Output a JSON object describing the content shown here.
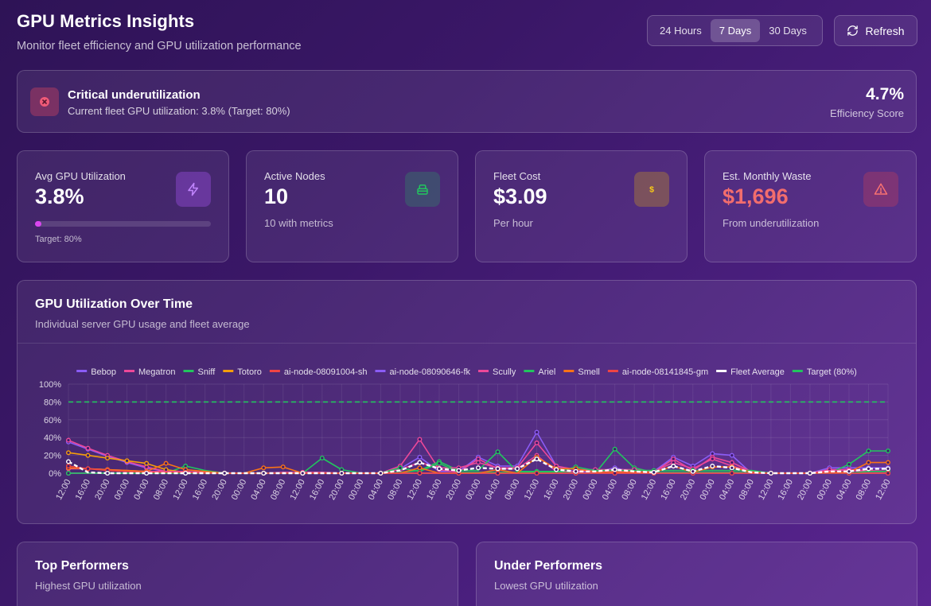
{
  "header": {
    "title": "GPU Metrics Insights",
    "subtitle": "Monitor fleet efficiency and GPU utilization performance"
  },
  "time_range": {
    "options": [
      "24 Hours",
      "7 Days",
      "30 Days"
    ],
    "selected": "7 Days"
  },
  "refresh_label": "Refresh",
  "alert": {
    "title": "Critical underutilization",
    "message": "Current fleet GPU utilization: 3.8% (Target: 80%)",
    "score": "4.7%",
    "score_label": "Efficiency Score",
    "icon": "x-circle-icon"
  },
  "stats": {
    "avg_gpu": {
      "label": "Avg GPU Utilization",
      "value": "3.8%",
      "progress": 0.038,
      "note": "Target: 80%",
      "icon": "lightning-icon"
    },
    "active_nodes": {
      "label": "Active Nodes",
      "value": "10",
      "sub": "10 with metrics",
      "icon": "server-icon"
    },
    "fleet_cost": {
      "label": "Fleet Cost",
      "value": "$3.09",
      "sub": "Per hour",
      "icon": "dollar-icon"
    },
    "monthly_waste": {
      "label": "Est. Monthly Waste",
      "value": "$1,696",
      "sub": "From underutilization",
      "icon": "warning-icon"
    }
  },
  "colors": {
    "accent": "#d946ef",
    "waste": "#f26d6d",
    "nodes_icon": "#22c55e",
    "cost_icon": "#facc15",
    "waste_icon": "#f87171",
    "lightning_icon": "#c084fc"
  },
  "chart_card": {
    "title": "GPU Utilization Over Time",
    "subtitle": "Individual server GPU usage and fleet average"
  },
  "chart_data": {
    "type": "line",
    "x": [
      "12:00",
      "16:00",
      "20:00",
      "00:00",
      "04:00",
      "08:00",
      "12:00",
      "16:00",
      "20:00",
      "00:00",
      "04:00",
      "08:00",
      "12:00",
      "16:00",
      "20:00",
      "00:00",
      "04:00",
      "08:00",
      "12:00",
      "16:00",
      "20:00",
      "00:00",
      "04:00",
      "08:00",
      "12:00",
      "16:00",
      "20:00",
      "00:00",
      "04:00",
      "08:00",
      "12:00",
      "16:00",
      "20:00",
      "00:00",
      "04:00",
      "08:00",
      "12:00",
      "16:00",
      "20:00",
      "00:00",
      "04:00",
      "08:00",
      "12:00"
    ],
    "ylim": [
      0,
      100
    ],
    "yticks": [
      "0%",
      "20%",
      "40%",
      "60%",
      "80%",
      "100%"
    ],
    "legend_position": "top",
    "grid": true,
    "series": [
      {
        "name": "Bebop",
        "color": "#8b5cf6",
        "values": [
          35,
          27,
          19,
          12,
          6,
          2,
          1,
          1,
          0,
          0,
          0,
          0,
          0,
          0,
          0,
          0,
          0,
          5,
          18,
          2,
          2,
          18,
          8,
          8,
          46,
          8,
          1,
          1,
          6,
          1,
          2,
          18,
          8,
          22,
          20,
          0,
          0,
          0,
          0,
          6,
          6,
          6,
          6
        ]
      },
      {
        "name": "Megatron",
        "color": "#ec4899",
        "values": [
          37,
          28,
          20,
          13,
          7,
          2,
          0,
          1,
          0,
          0,
          0,
          0,
          0,
          0,
          0,
          0,
          0,
          8,
          38,
          4,
          1,
          16,
          5,
          5,
          20,
          2,
          2,
          3,
          2,
          2,
          1,
          16,
          3,
          18,
          12,
          2,
          0,
          0,
          0,
          4,
          4,
          3,
          2
        ]
      },
      {
        "name": "Sniff",
        "color": "#22c55e",
        "values": [
          0,
          0,
          0,
          0,
          0,
          0,
          8,
          3,
          0,
          0,
          0,
          0,
          0,
          17,
          4,
          0,
          0,
          1,
          3,
          13,
          3,
          3,
          24,
          2,
          2,
          2,
          0,
          0,
          27,
          6,
          1,
          1,
          1,
          1,
          1,
          1,
          0,
          0,
          0,
          0,
          10,
          25,
          25
        ]
      },
      {
        "name": "Totoro",
        "color": "#f59e0b",
        "values": [
          23,
          20,
          17,
          14,
          11,
          4,
          1,
          0,
          0,
          0,
          0,
          0,
          0,
          0,
          0,
          0,
          0,
          0,
          0,
          0,
          0,
          0,
          0,
          0,
          0,
          0,
          0,
          0,
          0,
          0,
          0,
          0,
          0,
          0,
          0,
          0,
          0,
          0,
          0,
          0,
          0,
          0,
          0
        ]
      },
      {
        "name": "ai-node-08091004-sh",
        "color": "#ef4444",
        "values": [
          0,
          0,
          0,
          0,
          0,
          0,
          0,
          0,
          0,
          0,
          0,
          0,
          0,
          0,
          0,
          0,
          0,
          0,
          0,
          0,
          0,
          0,
          0,
          0,
          0,
          0,
          0,
          0,
          0,
          0,
          0,
          0,
          0,
          0,
          0,
          0,
          0,
          0,
          0,
          0,
          0,
          0,
          0
        ]
      },
      {
        "name": "ai-node-08090646-fk",
        "color": "#8b5cf6",
        "values": [
          0,
          0,
          0,
          0,
          0,
          0,
          0,
          0,
          0,
          0,
          0,
          0,
          0,
          0,
          0,
          0,
          0,
          0,
          0,
          0,
          0,
          0,
          0,
          0,
          0,
          0,
          0,
          0,
          0,
          0,
          0,
          0,
          0,
          0,
          0,
          0,
          0,
          0,
          0,
          0,
          0,
          0,
          0
        ]
      },
      {
        "name": "Scully",
        "color": "#ec4899",
        "values": [
          5,
          5,
          4,
          3,
          2,
          2,
          2,
          1,
          0,
          0,
          0,
          1,
          1,
          1,
          0,
          0,
          0,
          4,
          12,
          6,
          6,
          12,
          6,
          6,
          34,
          8,
          4,
          4,
          4,
          4,
          2,
          12,
          5,
          16,
          8,
          2,
          0,
          0,
          0,
          3,
          3,
          2,
          2
        ]
      },
      {
        "name": "Ariel",
        "color": "#22c55e",
        "values": [
          0,
          0,
          0,
          0,
          0,
          0,
          0,
          0,
          0,
          0,
          0,
          0,
          0,
          0,
          0,
          0,
          0,
          6,
          2,
          11,
          1,
          1,
          1,
          1,
          1,
          1,
          7,
          3,
          3,
          3,
          3,
          3,
          3,
          3,
          3,
          3,
          0,
          0,
          0,
          0,
          0,
          2,
          2
        ]
      },
      {
        "name": "Smell",
        "color": "#f97316",
        "values": [
          6,
          5,
          4,
          3,
          2,
          11,
          4,
          2,
          0,
          0,
          6,
          7,
          0,
          0,
          0,
          0,
          0,
          0,
          6,
          0,
          0,
          0,
          4,
          0,
          18,
          5,
          5,
          1,
          1,
          1,
          1,
          8,
          1,
          7,
          7,
          1,
          0,
          0,
          0,
          1,
          1,
          12,
          12
        ]
      },
      {
        "name": "ai-node-08141845-gm",
        "color": "#ef4444",
        "values": [
          8,
          5,
          3,
          2,
          1,
          1,
          1,
          0,
          0,
          0,
          0,
          0,
          0,
          0,
          0,
          0,
          0,
          0,
          0,
          0,
          0,
          0,
          0,
          0,
          0,
          0,
          0,
          0,
          0,
          0,
          0,
          0,
          0,
          0,
          0,
          0,
          0,
          0,
          0,
          0,
          0,
          0,
          0
        ]
      },
      {
        "name": "Fleet Average",
        "color": "#ffffff",
        "dashed": true,
        "values": [
          13,
          1,
          0,
          0,
          0,
          0,
          0,
          0,
          0,
          0,
          0,
          0,
          0,
          0,
          0,
          0,
          0,
          3,
          12,
          5,
          3,
          6,
          5,
          5,
          16,
          4,
          2,
          2,
          4,
          2,
          1,
          8,
          2,
          8,
          6,
          1,
          0,
          0,
          0,
          2,
          2,
          5,
          5
        ]
      },
      {
        "name": "Target (80%)",
        "color": "#22c55e",
        "dashed": true,
        "target": true,
        "values": [
          80,
          80,
          80,
          80,
          80,
          80,
          80,
          80,
          80,
          80,
          80,
          80,
          80,
          80,
          80,
          80,
          80,
          80,
          80,
          80,
          80,
          80,
          80,
          80,
          80,
          80,
          80,
          80,
          80,
          80,
          80,
          80,
          80,
          80,
          80,
          80,
          80,
          80,
          80,
          80,
          80,
          80,
          80
        ]
      }
    ]
  },
  "panels": {
    "top": {
      "title": "Top Performers",
      "subtitle": "Highest GPU utilization"
    },
    "under": {
      "title": "Under Performers",
      "subtitle": "Lowest GPU utilization"
    }
  }
}
